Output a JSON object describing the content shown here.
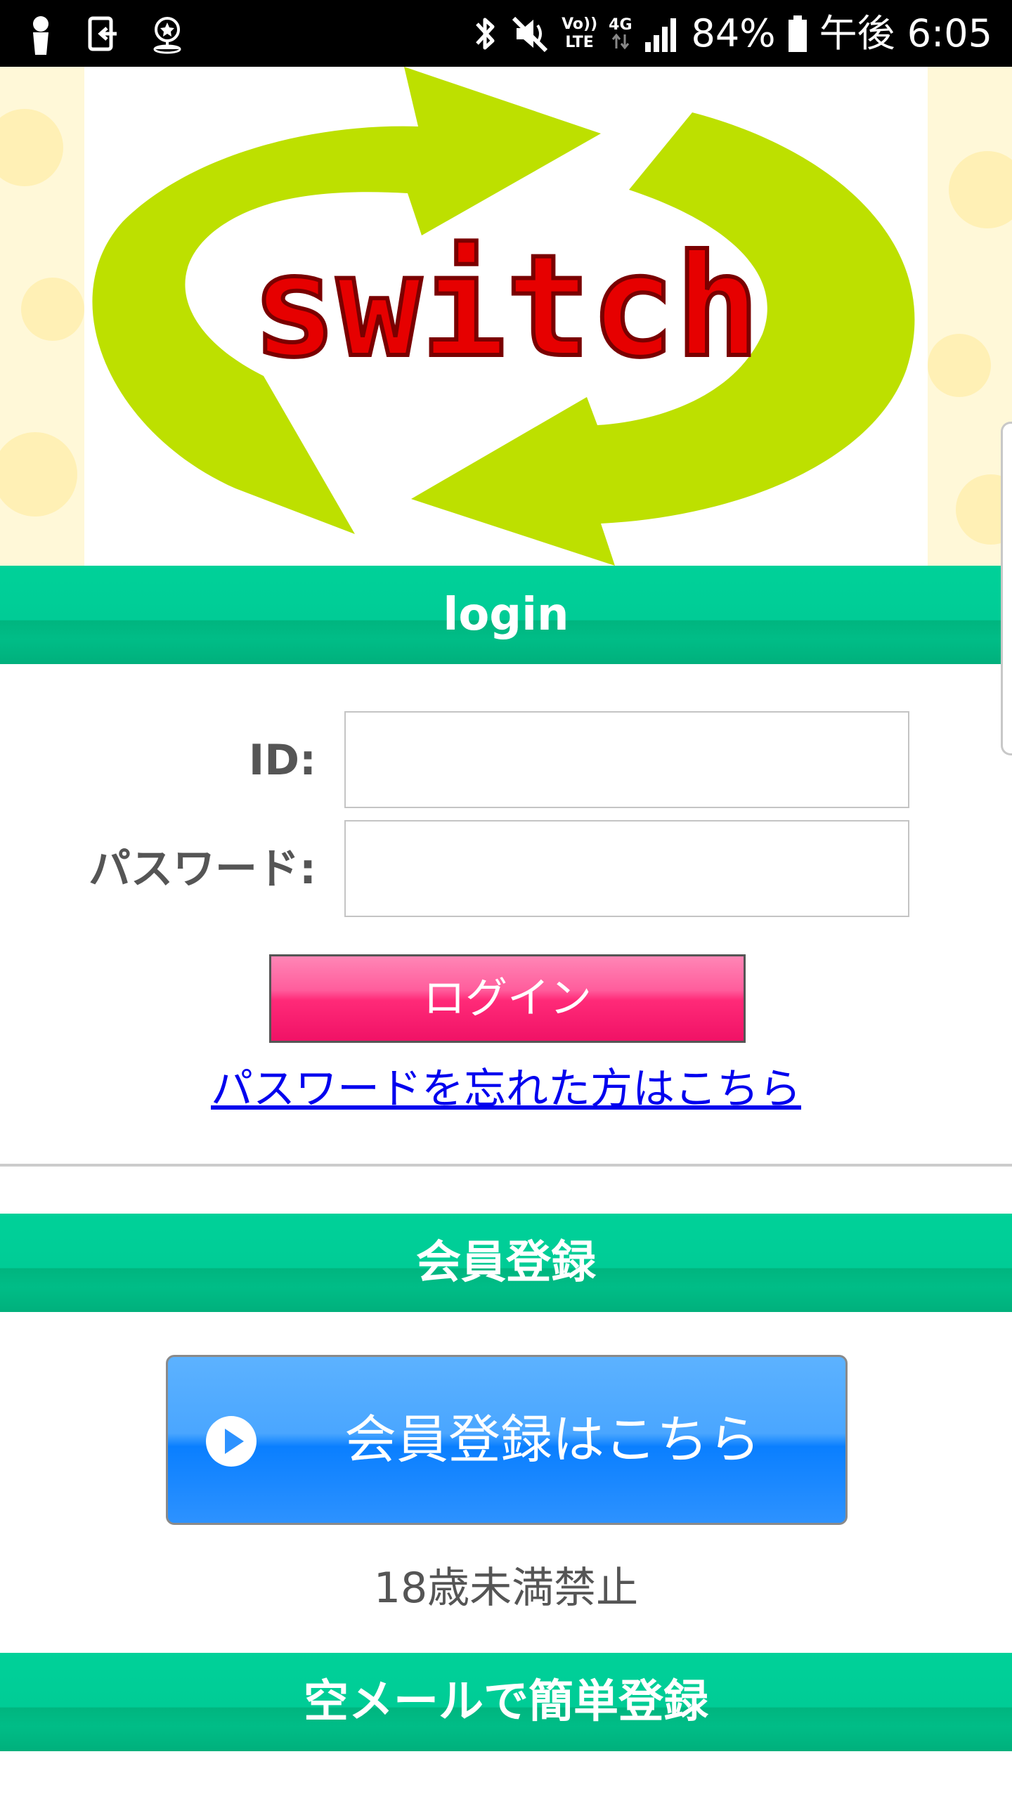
{
  "status_bar": {
    "battery_percent": "84%",
    "time": "午後 6:05",
    "network_volte": "Vo))",
    "network_lte": "LTE",
    "network_type": "4G",
    "icons": [
      "person-icon",
      "exit-icon",
      "location-star-icon",
      "bluetooth-icon",
      "mute-icon",
      "signal-icon",
      "battery-icon"
    ]
  },
  "header": {
    "logo_text": "switch",
    "logo_colors": {
      "arrow": "#bde000",
      "text": "#e60000"
    }
  },
  "login_section": {
    "title": "login",
    "id_label": "ID:",
    "id_value": "",
    "password_label": "パスワード:",
    "password_value": "",
    "login_button": "ログイン",
    "forgot_link": "パスワードを忘れた方はこちら"
  },
  "register_section": {
    "title": "会員登録",
    "register_button": "会員登録はこちら",
    "age_notice": "18歳未満禁止"
  },
  "empty_mail_section": {
    "title": "空メールで簡単登録"
  },
  "colors": {
    "section_header": "#00cc96",
    "login_button": "#ff2a78",
    "register_button": "#2d92ff",
    "link": "#0000ee"
  }
}
